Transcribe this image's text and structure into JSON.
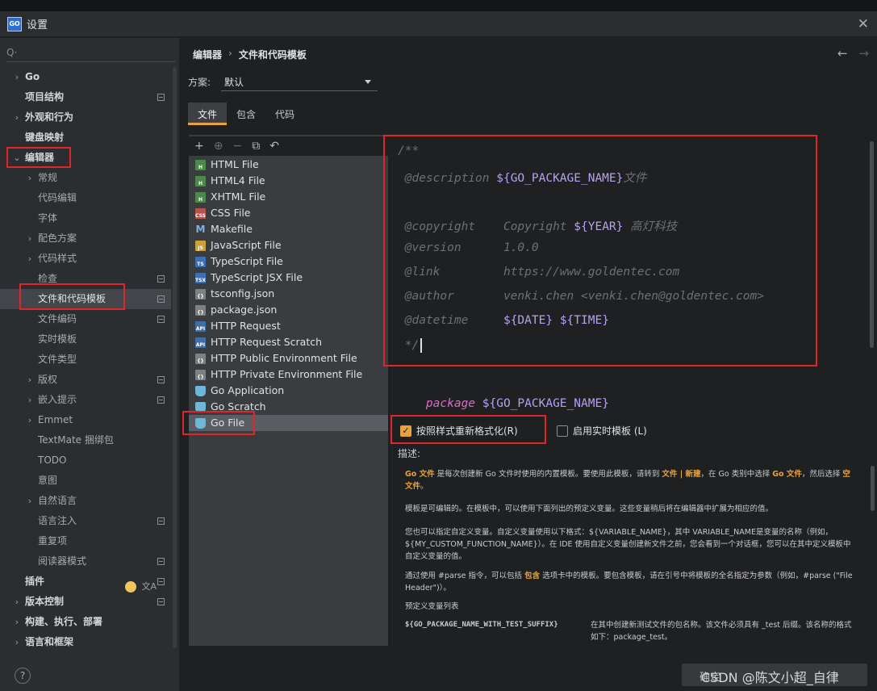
{
  "window": {
    "title": "设置",
    "logo_text": "GO",
    "close_icon": "close-icon"
  },
  "sidebar": {
    "search_glyph": "Q·",
    "items": [
      {
        "label": "Go",
        "arrow": "›",
        "level": 0,
        "bold": true
      },
      {
        "label": "项目结构",
        "arrow": "",
        "level": 0,
        "bold": true,
        "mark": true
      },
      {
        "label": "外观和行为",
        "arrow": "›",
        "level": 0,
        "bold": true
      },
      {
        "label": "键盘映射",
        "arrow": "",
        "level": 0,
        "bold": true
      },
      {
        "label": "编辑器",
        "arrow": "⌄",
        "level": 0,
        "bold": true,
        "expanded": true
      },
      {
        "label": "常规",
        "arrow": "›",
        "level": 1
      },
      {
        "label": "代码编辑",
        "arrow": "",
        "level": 1
      },
      {
        "label": "字体",
        "arrow": "",
        "level": 1
      },
      {
        "label": "配色方案",
        "arrow": "›",
        "level": 1
      },
      {
        "label": "代码样式",
        "arrow": "›",
        "level": 1
      },
      {
        "label": "检查",
        "arrow": "",
        "level": 1,
        "mark": true
      },
      {
        "label": "文件和代码模板",
        "arrow": "",
        "level": 1,
        "selected": true,
        "mark": true
      },
      {
        "label": "文件编码",
        "arrow": "",
        "level": 1,
        "mark": true
      },
      {
        "label": "实时模板",
        "arrow": "",
        "level": 1
      },
      {
        "label": "文件类型",
        "arrow": "",
        "level": 1
      },
      {
        "label": "版权",
        "arrow": "›",
        "level": 1,
        "mark": true
      },
      {
        "label": "嵌入提示",
        "arrow": "›",
        "level": 1,
        "mark": true
      },
      {
        "label": "Emmet",
        "arrow": "›",
        "level": 1
      },
      {
        "label": "TextMate 捆绑包",
        "arrow": "",
        "level": 1
      },
      {
        "label": "TODO",
        "arrow": "",
        "level": 1
      },
      {
        "label": "意图",
        "arrow": "",
        "level": 1
      },
      {
        "label": "自然语言",
        "arrow": "›",
        "level": 1
      },
      {
        "label": "语言注入",
        "arrow": "",
        "level": 1,
        "mark": true
      },
      {
        "label": "重复项",
        "arrow": "",
        "level": 1
      },
      {
        "label": "阅读器模式",
        "arrow": "",
        "level": 1,
        "mark": true
      },
      {
        "label": "插件",
        "arrow": "",
        "level": 0,
        "bold": true,
        "plugins": true
      },
      {
        "label": "版本控制",
        "arrow": "›",
        "level": 0,
        "bold": true,
        "mark": true
      },
      {
        "label": "构建、执行、部署",
        "arrow": "›",
        "level": 0,
        "bold": true
      },
      {
        "label": "语言和框架",
        "arrow": "›",
        "level": 0,
        "bold": true
      }
    ],
    "plugins_lang_glyph": "文A",
    "help_label": "?"
  },
  "main": {
    "breadcrumb": {
      "parent": "编辑器",
      "sep": "›",
      "current": "文件和代码模板"
    },
    "nav": {
      "back": "←",
      "forward": "→"
    },
    "scheme": {
      "label": "方案:",
      "value": "默认"
    },
    "tabs": [
      {
        "label": "文件",
        "active": true
      },
      {
        "label": "包含",
        "active": false
      },
      {
        "label": "代码",
        "active": false
      }
    ],
    "toolbar": {
      "add": "+",
      "add_child": "⊕",
      "remove": "−",
      "copy": "⧉",
      "reset": "↶"
    },
    "templates": [
      {
        "name": "HTML File",
        "icon": "html",
        "icon_text": "H"
      },
      {
        "name": "HTML4 File",
        "icon": "html",
        "icon_text": "H"
      },
      {
        "name": "XHTML File",
        "icon": "html",
        "icon_text": "H"
      },
      {
        "name": "CSS File",
        "icon": "css",
        "icon_text": "CSS"
      },
      {
        "name": "Makefile",
        "icon": "make",
        "icon_text": "M"
      },
      {
        "name": "JavaScript File",
        "icon": "js",
        "icon_text": "JS"
      },
      {
        "name": "TypeScript File",
        "icon": "ts",
        "icon_text": "TS"
      },
      {
        "name": "TypeScript JSX File",
        "icon": "ts",
        "icon_text": "TSX"
      },
      {
        "name": "tsconfig.json",
        "icon": "json",
        "icon_text": "{}"
      },
      {
        "name": "package.json",
        "icon": "json",
        "icon_text": "{}"
      },
      {
        "name": "HTTP Request",
        "icon": "api",
        "icon_text": "API"
      },
      {
        "name": "HTTP Request Scratch",
        "icon": "api",
        "icon_text": "API"
      },
      {
        "name": "HTTP Public Environment File",
        "icon": "json",
        "icon_text": "{}"
      },
      {
        "name": "HTTP Private Environment File",
        "icon": "json",
        "icon_text": "{}"
      },
      {
        "name": "Go Application",
        "icon": "go",
        "icon_text": ""
      },
      {
        "name": "Go Scratch",
        "icon": "go",
        "icon_text": ""
      },
      {
        "name": "Go File",
        "icon": "go",
        "icon_text": "",
        "selected": true
      }
    ],
    "code": {
      "open": "/**",
      "desc_tag": "@description",
      "desc_var": "${GO_PACKAGE_NAME}",
      "desc_text": "文件",
      "copyright_tag": "@copyright",
      "copyright_text": "Copyright",
      "year_var": "${YEAR}",
      "company": "高灯科技",
      "version_tag": "@version",
      "version_value": "1.0.0",
      "link_tag": "@link",
      "link_value": "https://www.goldentec.com",
      "author_tag": "@author",
      "author_value": "venki.chen <venki.chen@goldentec.com>",
      "datetime_tag": "@datetime",
      "date_var": "${DATE}",
      "time_var": "${TIME}",
      "close": "*/",
      "package_kw": "package",
      "package_var": "${GO_PACKAGE_NAME}"
    },
    "reformat_label": "按照样式重新格式化(R)",
    "live_template_label": "启用实时模板 (L)",
    "description_label": "描述:",
    "description": {
      "p1_a": "Go 文件",
      "p1_b": " 是每次创建新 Go 文件时使用的内置模板。要使用此模板，请转到 ",
      "p1_c": "文件 | 新建",
      "p1_d": "，在 Go 类别中选择 ",
      "p1_e": "Go 文件",
      "p1_f": "，然后选择 ",
      "p1_g": "空文件",
      "p1_h": "。",
      "p2": "模板是可编辑的。在模板中，可以使用下面列出的预定义变量。这些变量稍后将在编辑器中扩展为相应的值。",
      "p3": "您也可以指定自定义变量。自定义变量使用以下格式：${VARIABLE_NAME}，其中 VARIABLE_NAME是变量的名称（例如，${MY_CUSTOM_FUNCTION_NAME}）。在 IDE 使用自定义变量创建新文件之前，您会看到一个对话框，您可以在其中定义模板中自定义变量的值。",
      "p4_a": "通过使用 #parse 指令，可以包括 ",
      "p4_b": "包含",
      "p4_c": " 选项卡中的模板。要包含模板，请在引号中将模板的全名指定为参数（例如，#parse (\"File Header\")）。",
      "p5": "预定义变量列表",
      "var_name": "${GO_PACKAGE_NAME_WITH_TEST_SUFFIX}",
      "var_desc": "在其中创建新测试文件的包名称。该文件必须具有 _test 后缀。该名称的格式如下：package_test。"
    }
  },
  "watermark": {
    "ok_label": "确定",
    "text": "CSDN @陈文小超_自律"
  },
  "colors": {
    "accent": "#e6a23c",
    "highlight_box": "#e0262d",
    "variable": "#b8a0f0",
    "keyword": "#e06ac8"
  }
}
